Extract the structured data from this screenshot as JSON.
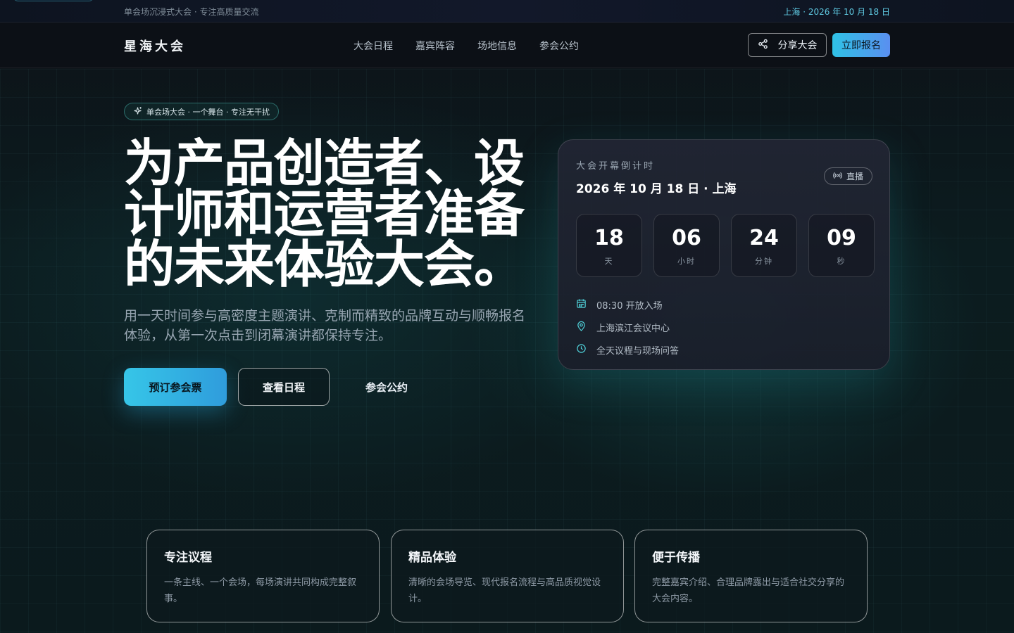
{
  "topbar": {
    "left_text": "单会场沉浸式大会 · 专注高质量交流",
    "right_text": "上海 · 2026 年 10 月 18 日"
  },
  "nav": {
    "brand": "星海大会",
    "links": [
      "大会日程",
      "嘉宾阵容",
      "场地信息",
      "参会公约"
    ],
    "share_label": "分享大会",
    "register_label": "立即报名"
  },
  "hero": {
    "tag": "单会场大会 · 一个舞台 · 专注无干扰",
    "headline": "为产品创造者、设计师和运营者准备的未来体验大会。",
    "subtitle": "用一天时间参与高密度主题演讲、克制而精致的品牌互动与顺畅报名体验，从第一次点击到闭幕演讲都保持专注。",
    "btn_primary": "预订参会票",
    "btn_secondary": "查看日程",
    "btn_text": "参会公约"
  },
  "countdown": {
    "label": "大会开幕倒计时",
    "date": "2026 年 10 月 18 日 · 上海",
    "live": "直播",
    "units": [
      {
        "value": "18",
        "label": "天"
      },
      {
        "value": "06",
        "label": "小时"
      },
      {
        "value": "24",
        "label": "分钟"
      },
      {
        "value": "09",
        "label": "秒"
      }
    ],
    "info": [
      {
        "icon": "calendar-icon",
        "text": "08:30 开放入场"
      },
      {
        "icon": "location-pin-icon",
        "text": "上海滨江会议中心"
      },
      {
        "icon": "clock-icon",
        "text": "全天议程与现场问答"
      }
    ]
  },
  "features": [
    {
      "title": "专注议程",
      "desc": "一条主线、一个会场，每场演讲共同构成完整叙事。"
    },
    {
      "title": "精品体验",
      "desc": "清晰的会场导览、现代报名流程与高品质视觉设计。"
    },
    {
      "title": "便于传播",
      "desc": "完整嘉宾介绍、合理品牌露出与适合社交分享的大会内容。"
    }
  ],
  "colors": {
    "accent": "#36c6e8",
    "background": "#0b1416",
    "icon_teal": "#4fd0d8"
  }
}
